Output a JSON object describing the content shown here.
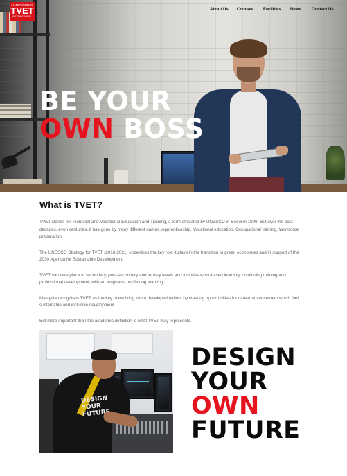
{
  "logo": {
    "top_text": "LIMKOKWING",
    "main_text": "TVET",
    "bottom_text": "INTERNATIONAL"
  },
  "nav": {
    "items": [
      "About Us",
      "Courses",
      "Facilities",
      "News",
      "Contact Us"
    ]
  },
  "hero": {
    "line1": "BE YOUR",
    "line2_red": "OWN",
    "line2_white": "BOSS"
  },
  "about": {
    "heading": "What is TVET?",
    "paragraphs": [
      "TVET stands for Technical and Vocational Education and Training, a term officiated by UNESCO in Seoul in 1999. But over the past decades, even centuries, it has gone by many different names. Apprenticeship. Vocational education. Occupational training. Workforce preparation.",
      "The UNESCO Strategy for TVET (2016-2021) underlines the key role it plays in the transition to green economies and in support of the 2030 Agenda for Sustainable Development.",
      "TVET can take place at secondary, post-secondary and tertiary levels and includes work-based learning, continuing training and professional development, with an emphasis on lifelong learning.",
      "Malaysia recognises TVET as the key to evolving into a developed nation, by creating opportunities for career advancement which fuel sustainable and inclusive development.",
      "But more important than the academic definition is what TVET truly represents."
    ]
  },
  "tagline": {
    "line1": "DESIGN",
    "line2": "YOUR",
    "line3_red": "OWN",
    "line4": "FUTURE"
  },
  "shirt_print": "DESIGN YOUR FUTURE",
  "colors": {
    "brand_red": "#e6141e",
    "heading": "#111111",
    "body_text": "#666666"
  }
}
